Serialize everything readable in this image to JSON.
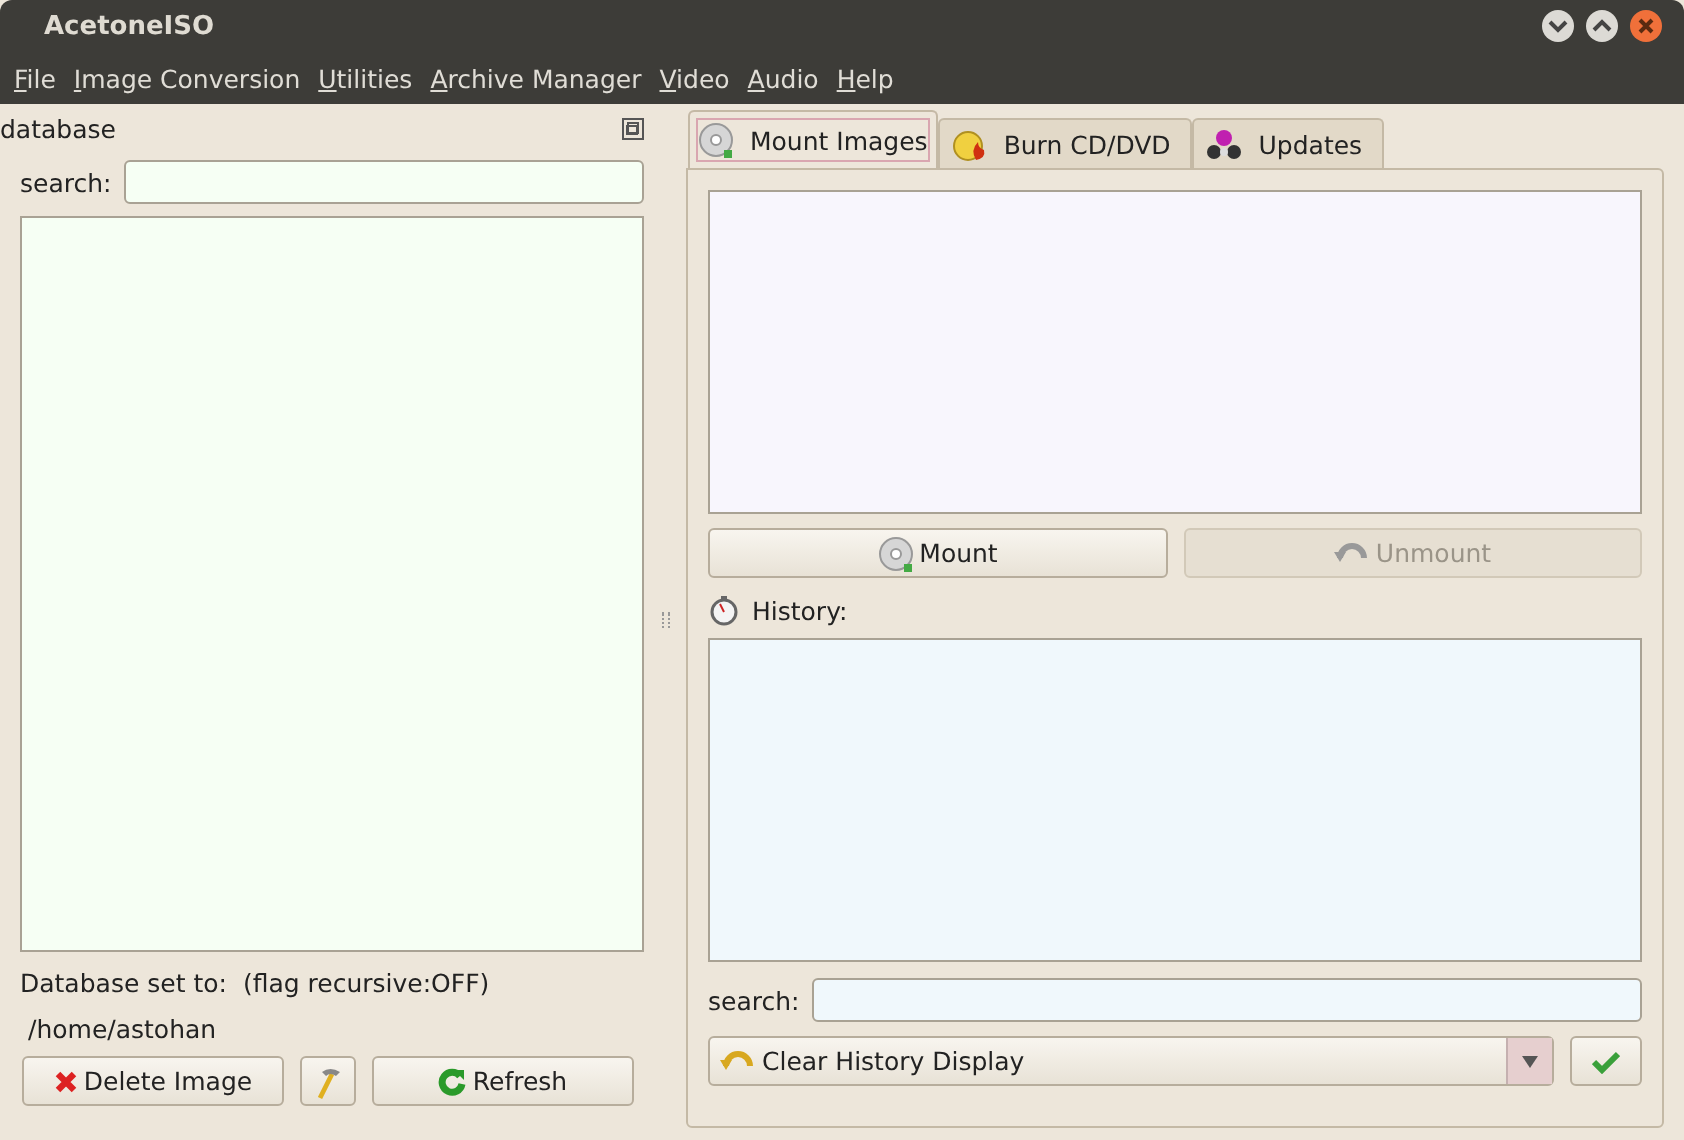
{
  "window": {
    "title": "AcetoneISO"
  },
  "menu": [
    "File",
    "Image Conversion",
    "Utilities",
    "Archive Manager",
    "Video",
    "Audio",
    "Help"
  ],
  "database_panel": {
    "title": "database",
    "search_label": "search:",
    "database_label": "Database set to:",
    "flag": "(flag recursive:OFF)",
    "path": "/home/astohan",
    "buttons": [
      {
        "kind": "delete",
        "label": "Delete Image"
      },
      {
        "kind": "tool"
      },
      {
        "kind": "refresh",
        "label": "Refresh"
      }
    ]
  },
  "tabs": [
    {
      "label": "Mount Images",
      "kind": "disc",
      "selected": true
    },
    {
      "label": "Burn CD/DVD",
      "kind": "burn",
      "selected": false
    },
    {
      "label": "Updates",
      "kind": "molecule",
      "selected": false
    }
  ],
  "mount_buttons": [
    {
      "label": "Mount",
      "kind": "disc",
      "disabled": false
    },
    {
      "label": "Unmount",
      "kind": "undo",
      "disabled": true
    }
  ],
  "history": {
    "label": "History:",
    "search_label": "search:",
    "action": "Clear History Display"
  }
}
